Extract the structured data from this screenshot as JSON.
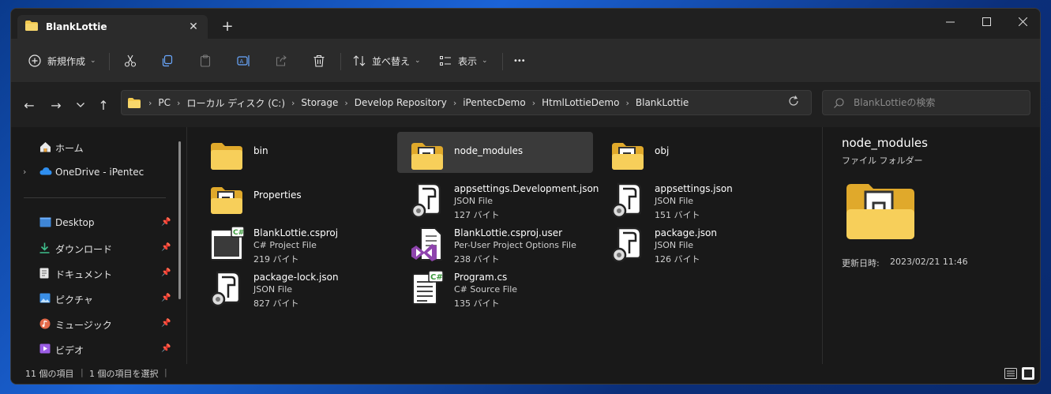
{
  "window": {
    "tab_title": "BlankLottie",
    "tab_close": "✕",
    "new_tab": "+"
  },
  "controls": {
    "minimize": "—",
    "maximize": "☐",
    "close": "✕"
  },
  "toolbar": {
    "new_label": "新規作成",
    "sort_label": "並べ替え",
    "view_label": "表示",
    "more_label": "•••"
  },
  "nav": {
    "back": "←",
    "forward": "→",
    "history": "⌄",
    "up": "↑"
  },
  "address": {
    "crumbs": [
      "PC",
      "ローカル ディスク (C:)",
      "Storage",
      "Develop Repository",
      "iPentecDemo",
      "HtmlLottieDemo",
      "BlankLottie"
    ]
  },
  "search": {
    "placeholder": "BlankLottieの検索"
  },
  "sidebar": {
    "items": [
      {
        "label": "ホーム"
      },
      {
        "label": "OneDrive - iPentec"
      },
      {
        "label": "Desktop"
      },
      {
        "label": "ダウンロード"
      },
      {
        "label": "ドキュメント"
      },
      {
        "label": "ピクチャ"
      },
      {
        "label": "ミュージック"
      },
      {
        "label": "ビデオ"
      }
    ]
  },
  "files": [
    {
      "name": "bin",
      "kind": "folder"
    },
    {
      "name": "node_modules",
      "kind": "folder-doc"
    },
    {
      "name": "obj",
      "kind": "folder-doc"
    },
    {
      "name": "Properties",
      "kind": "folder-doc"
    },
    {
      "name": "appsettings.Development.json",
      "type": "JSON File",
      "size": "127 バイト",
      "kind": "json"
    },
    {
      "name": "appsettings.json",
      "type": "JSON File",
      "size": "151 バイト",
      "kind": "json"
    },
    {
      "name": "BlankLottie.csproj",
      "type": "C# Project File",
      "size": "219 バイト",
      "kind": "csproj"
    },
    {
      "name": "BlankLottie.csproj.user",
      "type": "Per-User Project Options File",
      "size": "238 バイト",
      "kind": "vsuser"
    },
    {
      "name": "package.json",
      "type": "JSON File",
      "size": "126 バイト",
      "kind": "json"
    },
    {
      "name": "package-lock.json",
      "type": "JSON File",
      "size": "827 バイト",
      "kind": "json"
    },
    {
      "name": "Program.cs",
      "type": "C# Source File",
      "size": "135 バイト",
      "kind": "cs"
    }
  ],
  "details": {
    "title": "node_modules",
    "subtitle": "ファイル フォルダー",
    "modified_label": "更新日時:",
    "modified_value": "2023/02/21 11:46"
  },
  "status": {
    "count": "11 個の項目",
    "selected": "1 個の項目を選択"
  },
  "colors": {
    "folder": "#f3c94f",
    "accent_cs": "#3c9a3c",
    "vs_purple": "#8e44ad",
    "selection": "#3a3a3a"
  }
}
